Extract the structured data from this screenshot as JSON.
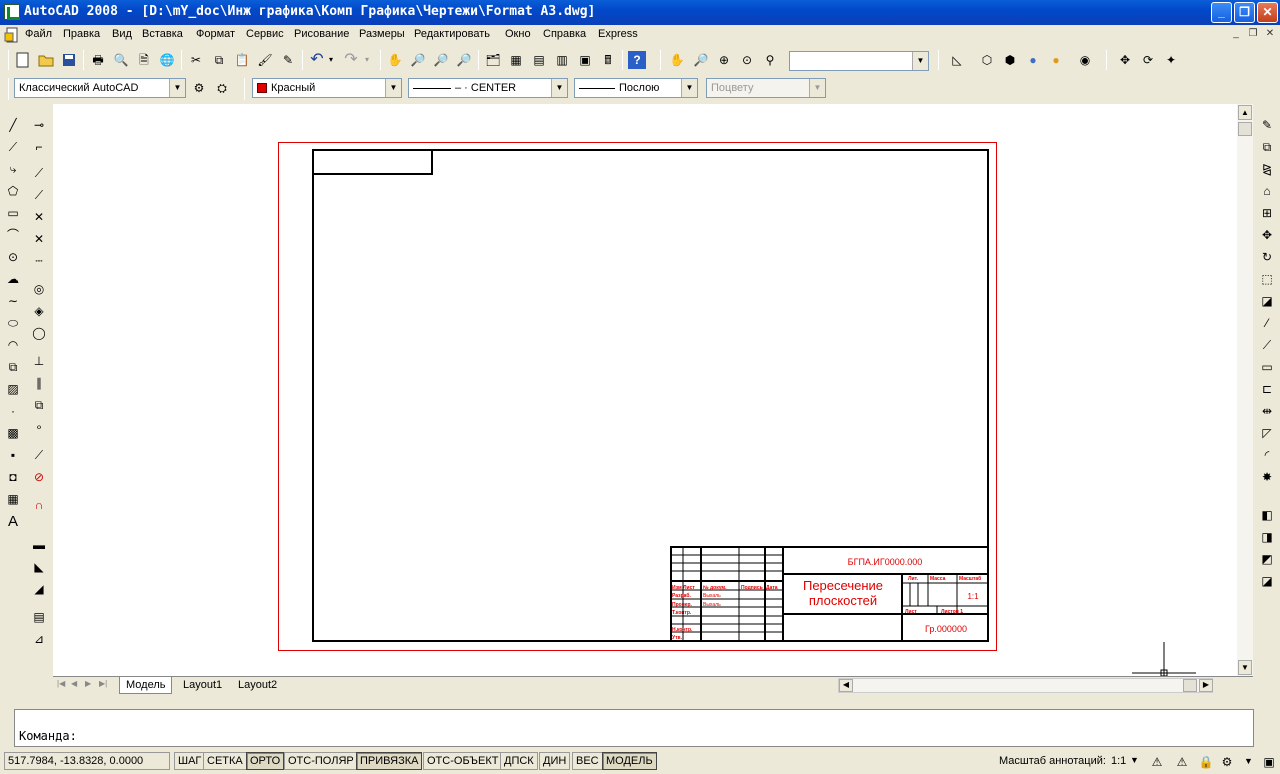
{
  "window": {
    "title": "AutoCAD 2008 - [D:\\mY_doc\\Инж графика\\Комп Графика\\Чертежи\\Format A3.dwg]"
  },
  "menu": [
    "Файл",
    "Правка",
    "Вид",
    "Вставка",
    "Формат",
    "Сервис",
    "Рисование",
    "Размеры",
    "Редактировать",
    "Окно",
    "Справка",
    "Express"
  ],
  "toolbar": {
    "workspace": "Классический AutoCAD",
    "color": "Красный",
    "linetype": "CENTER",
    "lineweight": "Послою",
    "plotstyle": "Поцвету",
    "named_view": ""
  },
  "tabs": [
    "Модель",
    "Layout1",
    "Layout2"
  ],
  "command": {
    "prompt": "Команда:"
  },
  "status": {
    "coords": "517.7984, -13.8328, 0.0000",
    "buttons": [
      "ШАГ",
      "СЕТКА",
      "ОРТО",
      "ОТС-ПОЛЯР",
      "ПРИВЯЗКА",
      "ОТС-ОБЪЕКТ",
      "ДПСК",
      "ДИН",
      "ВЕС",
      "МОДЕЛЬ"
    ],
    "annotation_label": "Масштаб аннотаций:",
    "annotation_value": "1:1"
  },
  "drawing": {
    "code": "БГПА.ИГ0000.000",
    "title_line1": "Пересечение",
    "title_line2": "плоскостей",
    "scale": "1:1",
    "group": "Гр.000000",
    "hdr_lit": "Лит.",
    "hdr_mass": "Масса",
    "hdr_scale": "Масштаб",
    "sheet": "Лист",
    "sheets": "Листов 1",
    "row_izm": "Изм Лист",
    "row_doc": "№ докум.",
    "row_sign": "Подпись",
    "row_date": "Дата",
    "razrab": "Разраб.",
    "prover": "Провер.",
    "tkontr": "Т.контр.",
    "nkontr": "Н.контр.",
    "utv": "Утв.",
    "name1": "Выхаль",
    "name2": "Выхаль"
  },
  "colors": {
    "accent_red": "#e00000",
    "titlebar": "#0148c9"
  }
}
